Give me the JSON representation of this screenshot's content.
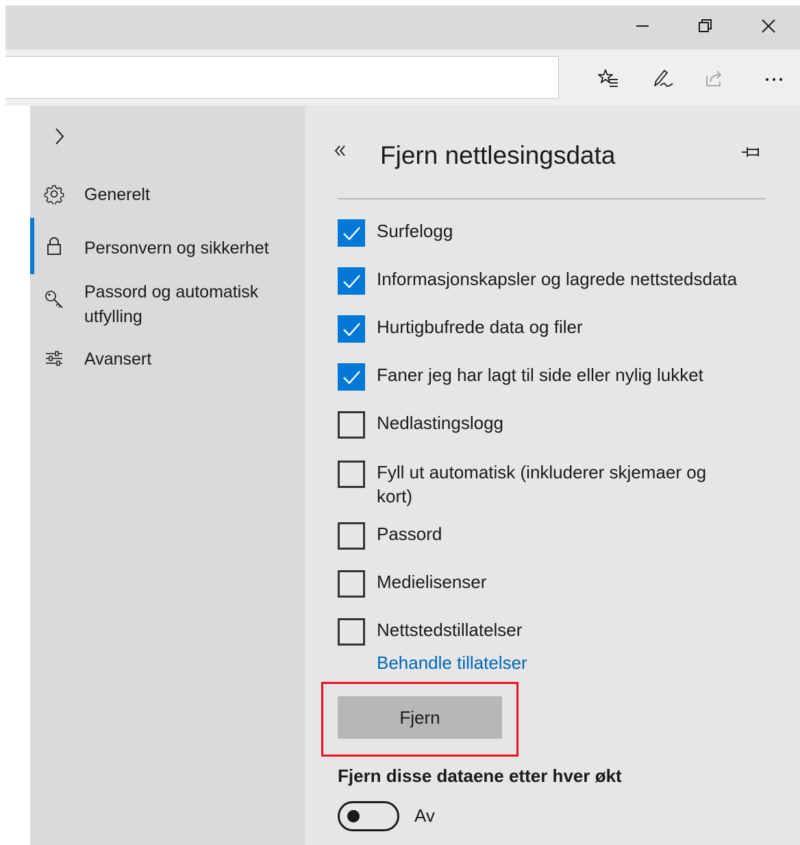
{
  "window": {
    "controls": [
      "minimize-icon",
      "restore-icon",
      "close-icon"
    ]
  },
  "toolbar": {
    "address_value": "",
    "icons": [
      "favorites-list-icon",
      "pen-notes-icon",
      "share-icon",
      "more-icon"
    ]
  },
  "sidebar": {
    "expand_icon": "chevron-right-icon",
    "items": [
      {
        "label": "Generelt",
        "icon": "gear-icon",
        "active": false
      },
      {
        "label": "Personvern og sikkerhet",
        "icon": "lock-icon",
        "active": true
      },
      {
        "label": "Passord og automatisk utfylling",
        "icon": "key-icon",
        "active": false
      },
      {
        "label": "Avansert",
        "icon": "sliders-icon",
        "active": false
      }
    ]
  },
  "panel": {
    "back_icon": "double-chevron-left-icon",
    "title": "Fjern nettlesingsdata",
    "pin_icon": "pin-icon",
    "checkboxes": [
      {
        "label": "Surfelogg",
        "checked": true
      },
      {
        "label": "Informasjonskapsler og lagrede nettstedsdata",
        "checked": true
      },
      {
        "label": "Hurtigbufrede data og filer",
        "checked": true
      },
      {
        "label": "Faner jeg har lagt til side eller nylig lukket",
        "checked": true
      },
      {
        "label": "Nedlastingslogg",
        "checked": false
      },
      {
        "label": "Fyll ut automatisk (inkluderer skjemaer og kort)",
        "checked": false
      },
      {
        "label": "Passord",
        "checked": false
      },
      {
        "label": "Medielisenser",
        "checked": false
      },
      {
        "label": "Nettstedstillatelser",
        "checked": false
      }
    ],
    "manage_link": "Behandle tillatelser",
    "clear_button": "Fjern",
    "auto_clear_label": "Fjern disse dataene etter hver økt",
    "auto_clear_toggle": {
      "on": false,
      "state_label": "Av"
    }
  },
  "colors": {
    "accent": "#0078d7",
    "link": "#0067b8",
    "highlight_box": "#e81123"
  }
}
